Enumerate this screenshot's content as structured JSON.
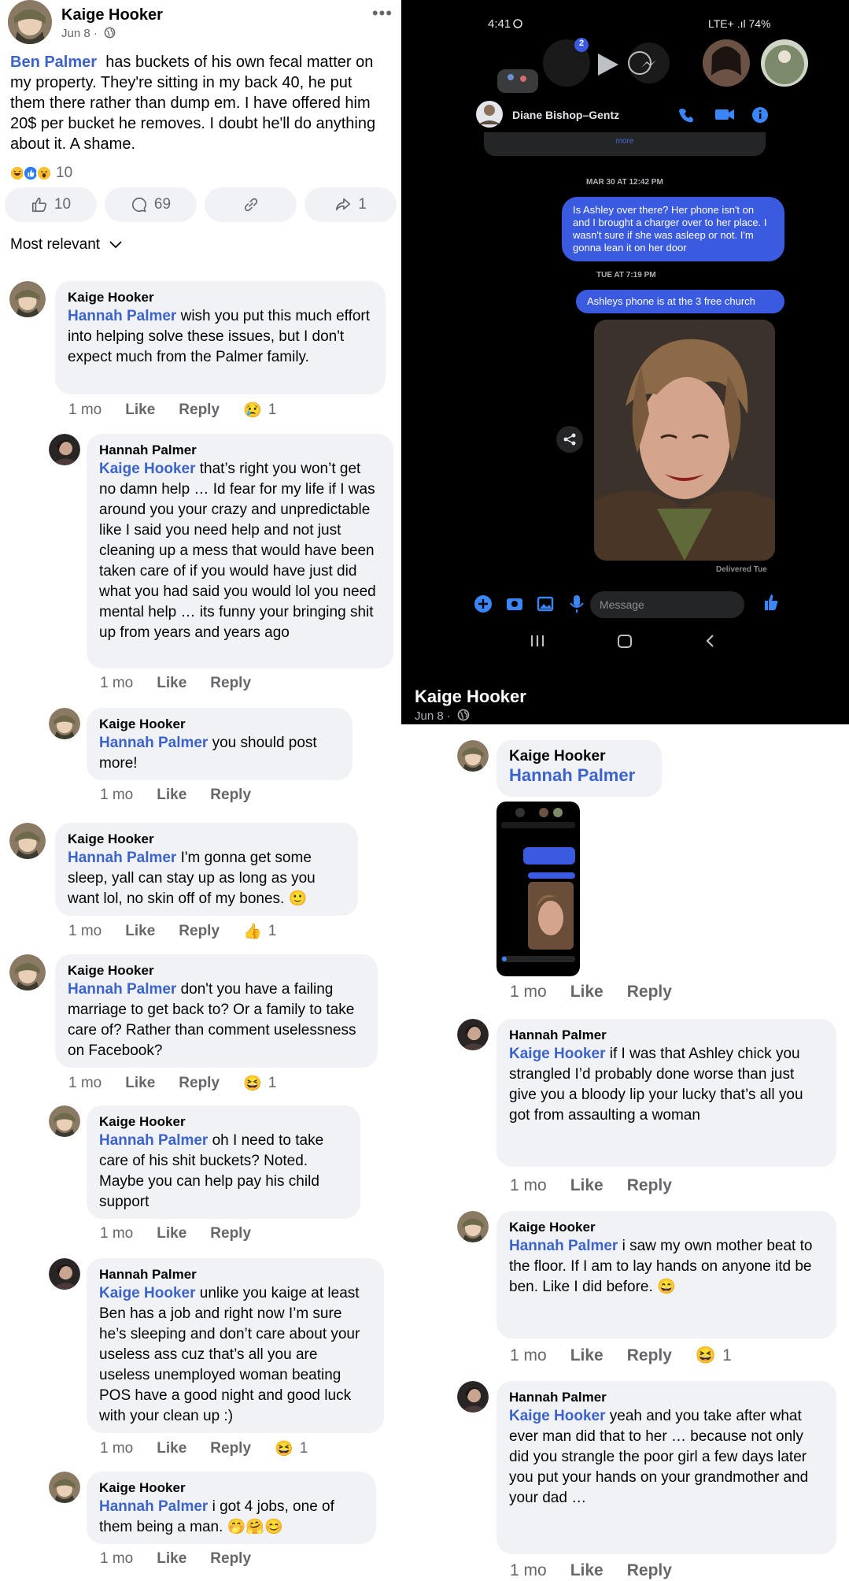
{
  "post": {
    "author": "Kaige Hooker",
    "date": "Jun 8",
    "date_sep": "·",
    "more": "•••",
    "mention": "Ben Palmer",
    "text": "has buckets of his own fecal matter on my property. They're sitting in my back 40, he put them there rather than dump em.  I have offered him 20$ per bucket he removes. I doubt he'll do anything about it. A shame.",
    "reaction_count": "10",
    "actions": {
      "like_count": "10",
      "comment_count": "69",
      "share_count": "1"
    },
    "sort_label": "Most relevant"
  },
  "meta_labels": {
    "like": "Like",
    "reply": "Reply"
  },
  "comments_left": [
    {
      "author": "Kaige Hooker",
      "mention": "Hannah Palmer",
      "text": "wish you put this much effort into helping solve these issues, but I don't expect much from the Palmer family.",
      "time": "1 mo",
      "reaction": "😢",
      "reaction_count": "1"
    },
    {
      "author": "Hannah Palmer",
      "mention": "Kaige Hooker",
      "text": " that’s right you won’t get no damn help … Id fear for my life if I was around you your crazy and unpredictable like I said you need help and not just cleaning up a mess that would have been taken care of if you would have just did what you had said you would lol you need mental help … its funny your bringing shit up from years and years ago",
      "time": "1 mo"
    },
    {
      "author": "Kaige Hooker",
      "mention": "Hannah Palmer",
      "text": "you should post more!",
      "time": "1 mo"
    },
    {
      "author": "Kaige Hooker",
      "mention": "Hannah Palmer",
      "text": "I'm gonna get some sleep, yall can stay up as long as you want lol, no skin off of my bones. 🙂",
      "time": "1 mo",
      "reaction": "👍",
      "reaction_count": "1"
    },
    {
      "author": "Kaige Hooker",
      "mention": "Hannah Palmer",
      "text": "don't you have a failing marriage to get back to? Or a family to take care of? Rather than comment uselessness on Facebook?",
      "time": "1 mo",
      "reaction": "😆",
      "reaction_count": "1"
    },
    {
      "author": "Kaige Hooker",
      "mention": "Hannah Palmer",
      "text": "oh I need to take care of his shit buckets? Noted. Maybe you can help pay his child support",
      "time": "1 mo"
    },
    {
      "author": "Hannah Palmer",
      "mention": "Kaige Hooker",
      "text": "unlike you kaige at least Ben has a job and right now I’m sure he’s sleeping and don’t care about your useless ass cuz that’s all you are useless unemployed woman beating POS have a good night and good luck with your clean up :)",
      "time": "1 mo",
      "reaction": "😆",
      "reaction_count": "1"
    },
    {
      "author": "Kaige Hooker",
      "mention": "Hannah Palmer",
      "text": "i got 4 jobs, one of them being a man. 🤭🤗😊",
      "time": "1 mo"
    }
  ],
  "phone": {
    "status_time": "4:41",
    "status_right": "LTE+ .ıl 74%",
    "badge": "2",
    "contact_name": "Diane Bishop–Gentz",
    "more_text": "more",
    "stamp1": "MAR 30 AT 12:42 PM",
    "msg1": "Is Ashley over there? Her phone isn't on and I brought a charger over to her place. I wasn't sure if she was asleep or not. I'm gonna lean it on her door",
    "stamp2": "TUE AT 7:19 PM",
    "msg2": "Ashleys phone is at the 3 free church",
    "delivered": "Delivered Tue",
    "compose_placeholder": "Message",
    "footer_author": "Kaige Hooker",
    "footer_date": "Jun 8",
    "footer_sep": "·"
  },
  "comments_right": [
    {
      "author": "Kaige Hooker",
      "mention": "Hannah Palmer",
      "time": "1 mo"
    },
    {
      "author": "Hannah Palmer",
      "mention": "Kaige Hooker",
      "text": "if I was that Ashley chick you strangled I’d probably done worse than just give you a bloody lip your lucky that’s all you got from assaulting a woman",
      "time": "1 mo"
    },
    {
      "author": "Kaige Hooker",
      "mention": "Hannah Palmer",
      "text": "i saw my own mother beat to the floor. If  I am to lay hands on anyone itd be ben. Like I did before. 😄",
      "time": "1 mo",
      "reaction": "😆",
      "reaction_count": "1"
    },
    {
      "author": "Hannah Palmer",
      "mention": "Kaige Hooker",
      "text": "yeah and you take after what ever man did that to her … because not only did you strangle the poor girl a few days later you put your hands on your grandmother and your dad …",
      "time": "1 mo"
    }
  ],
  "colors": {
    "mention": "#3b63c9",
    "bubble": "#f0f2f5",
    "messenger_blue": "#3a5be0",
    "meta": "#65676b"
  },
  "icons": [
    "like-icon",
    "comment-icon",
    "link-icon",
    "share-icon",
    "chevron-down-icon",
    "globe-icon",
    "phone-icon",
    "video-icon",
    "info-icon",
    "share-arrow-icon",
    "plus-icon",
    "camera-icon",
    "image-icon",
    "mic-icon",
    "thumbs-up-icon"
  ]
}
